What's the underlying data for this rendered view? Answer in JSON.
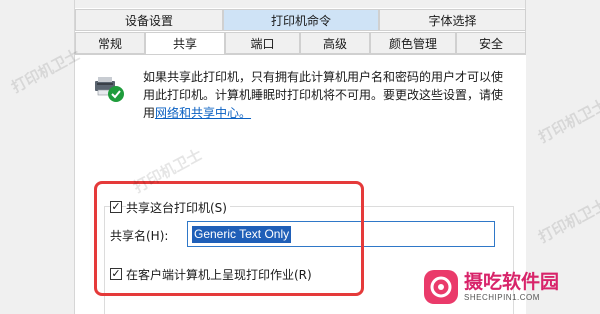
{
  "tabs_row1": [
    {
      "label": "设备设置"
    },
    {
      "label": "打印机命令"
    },
    {
      "label": "字体选择"
    }
  ],
  "tabs_row2": [
    {
      "label": "常规"
    },
    {
      "label": "共享"
    },
    {
      "label": "端口"
    },
    {
      "label": "高级"
    },
    {
      "label": "颜色管理"
    },
    {
      "label": "安全"
    }
  ],
  "active_tab": "共享",
  "description": {
    "text": "如果共享此打印机，只有拥有此计算机用户名和密码的用户才可以使用此打印机。计算机睡眠时打印机将不可用。要更改这些设置，请使用",
    "link": "网络和共享中心。"
  },
  "share": {
    "checkbox_label": "共享这台打印机(S)",
    "checked": true,
    "name_label": "共享名(H):",
    "name_value": "Generic  Text Only"
  },
  "render": {
    "checkbox_label": "在客户端计算机上呈现打印作业(R)",
    "checked": true
  },
  "watermark": "打印机卫士",
  "brand": {
    "name": "摄吃软件园",
    "url": "SHECHIPIN1.COM"
  },
  "colors": {
    "highlight_box": "#e53a3a",
    "link": "#0a60c2",
    "selection": "#1f5fb8",
    "brand": "#d8246a"
  }
}
